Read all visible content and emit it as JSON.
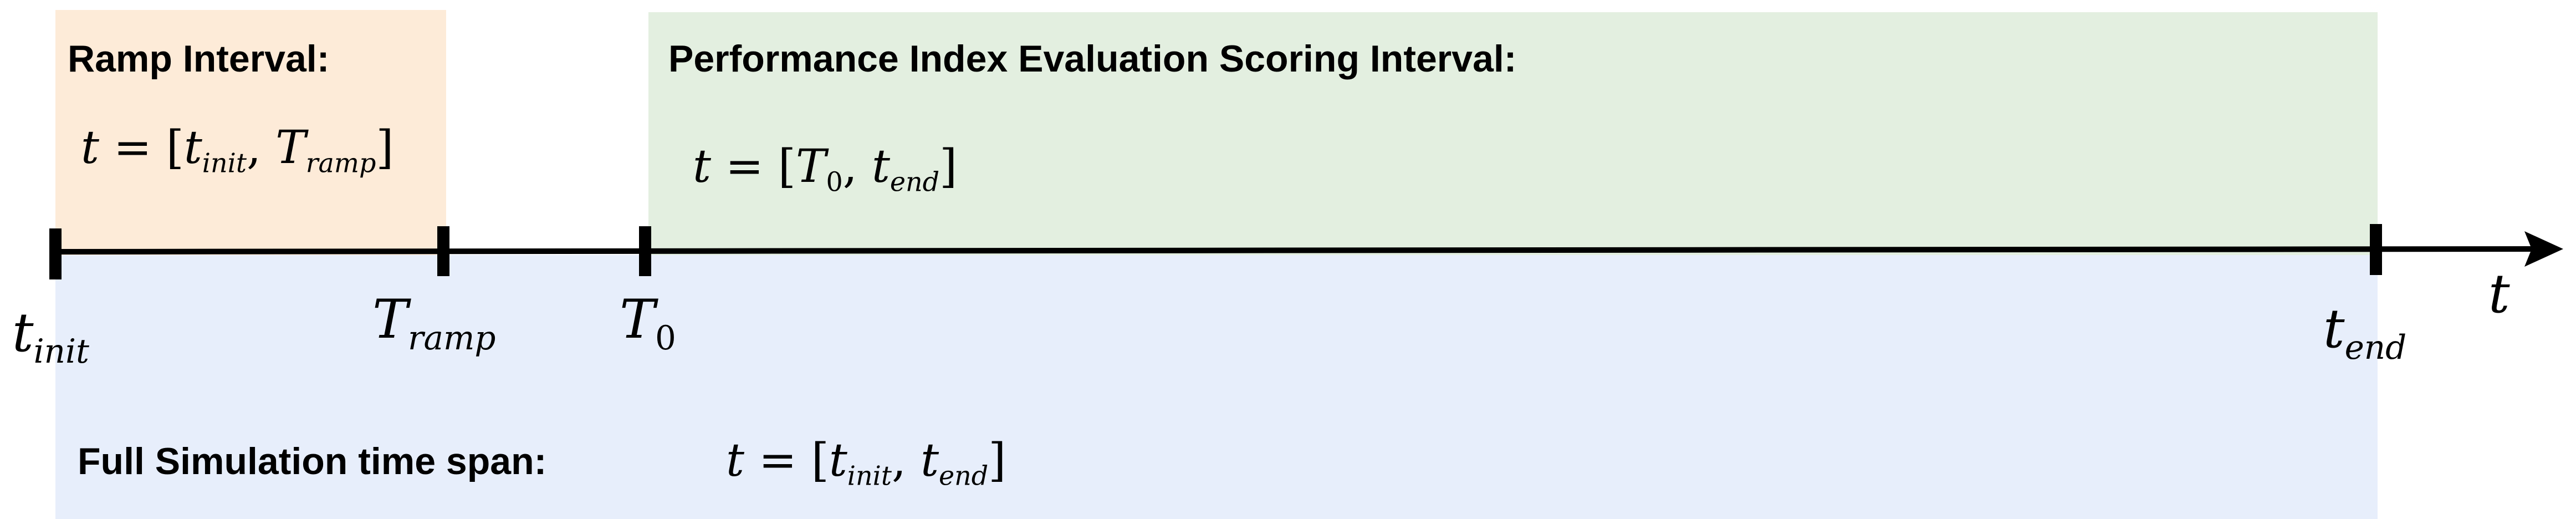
{
  "regions": {
    "ramp": {
      "heading": "Ramp Interval:",
      "color": "#fdebd8"
    },
    "scoring": {
      "heading": "Performance Index Evaluation Scoring Interval:",
      "color": "#e3efe0"
    },
    "full": {
      "heading": "Full Simulation time span:",
      "color": "#e7eefb"
    }
  },
  "symbols": {
    "t": "t",
    "equals": "=",
    "open_bracket": "[",
    "close_bracket": "]",
    "comma": ",",
    "T": "T",
    "init": "init",
    "ramp": "ramp",
    "end": "end",
    "zero": "0"
  },
  "colors": {
    "axis": "#000000"
  }
}
